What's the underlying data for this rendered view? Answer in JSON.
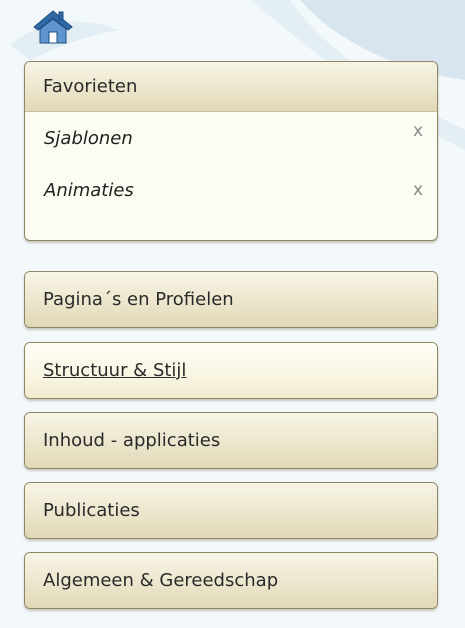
{
  "colors": {
    "background": "#f3f8fb",
    "panel_header": "#ece6cd",
    "panel_body": "#fdfcf3",
    "border": "#8e8563",
    "home_icon": "#2f6aa6"
  },
  "home": {
    "icon": "house-icon"
  },
  "favorites": {
    "title": "Favorieten",
    "items": [
      {
        "label": "Sjablonen",
        "remove": "x"
      },
      {
        "label": "Animaties",
        "remove": "x"
      }
    ]
  },
  "nav": {
    "items": [
      {
        "label": "Pagina´s en Profielen",
        "active": false
      },
      {
        "label": "Structuur & Stijl",
        "active": true
      },
      {
        "label": "Inhoud - applicaties",
        "active": false
      },
      {
        "label": "Publicaties",
        "active": false
      },
      {
        "label": "Algemeen & Gereedschap",
        "active": false
      }
    ]
  }
}
